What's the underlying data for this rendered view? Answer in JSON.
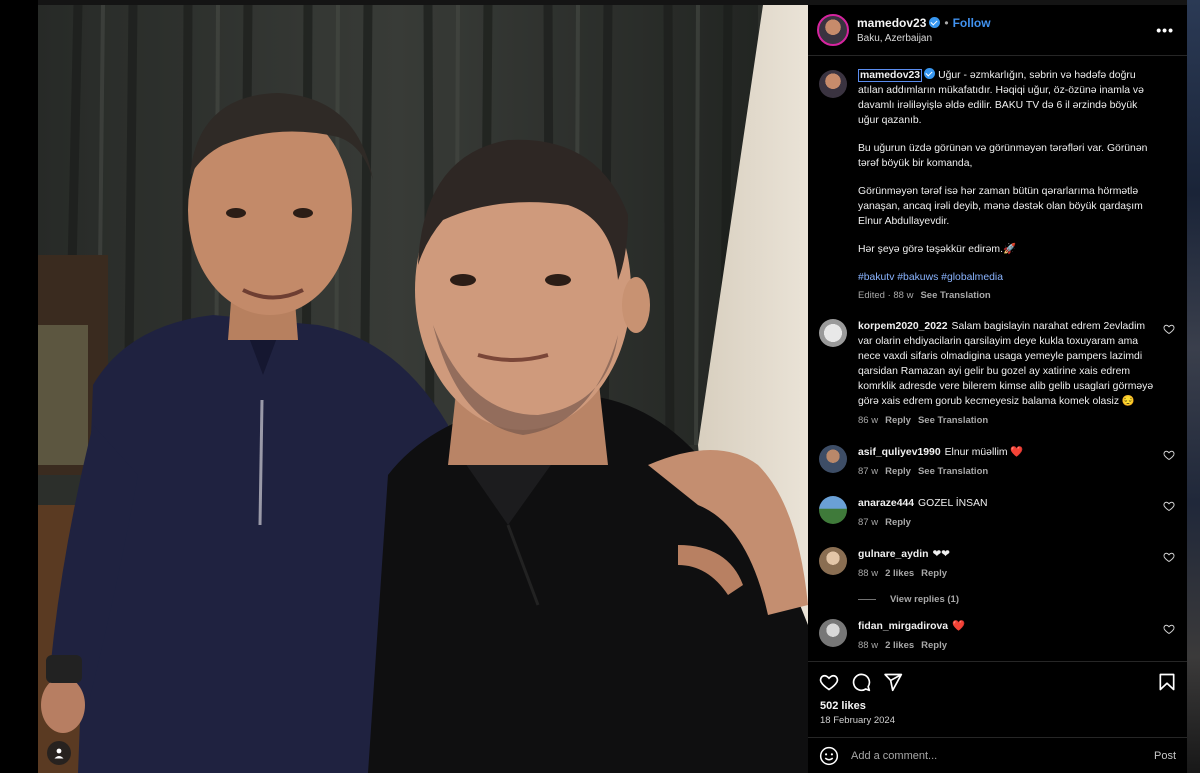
{
  "post": {
    "username": "mamedov23",
    "follow_label": "Follow",
    "dot": "•",
    "location": "Baku, Azerbaijan",
    "more_label": "•••"
  },
  "caption": {
    "username": "mamedov23",
    "p1": "Uğur - əzmkarlığın, səbrin və hədəfə doğru atılan addımların mükafatıdır. Həqiqi uğur, öz-özünə inamla və davamlı irəliləyişlə əldə edilir. BAKU TV də 6 il ərzində böyük uğur qazanıb.",
    "p2": "Bu uğurun üzdə görünən və görünməyən tərəfləri var. Görünən tərəf böyük bir komanda,",
    "p3": "Görünməyən tərəf isə hər zaman bütün qərarlarıma hörmətlə yanaşan, ancaq irəli deyib, mənə dəstək olan böyük qardaşım Elnur Abdullayevdir.",
    "p4": "Hər şeyə görə təşəkkür edirəm.🚀",
    "hashtags": "#bakutv #bakuws #globalmedia",
    "edited": "Edited · 88 w",
    "see_translation": "See Translation"
  },
  "comments": [
    {
      "user": "korpem2020_2022",
      "text": "Salam bagislayin narahat edrem 2evladim var olarin ehdiyacilarin qarsilayim deye kukla toxuyaram ama nece vaxdi sifaris olmadigina usaga yemeyle pampers lazimdi qarsidan Ramazan ayi gelir bu gozel ay xatirine xais edrem komrklik adresde vere bilerem kimse alib gelib usaglari görməyə görə xais edrem gorub kecmeyesiz balama komek olasiz 😔",
      "time": "86 w",
      "reply": "Reply",
      "translate": "See Translation",
      "likes": ""
    },
    {
      "user": "asif_quliyev1990",
      "text": "Elnur müəllim ❤️",
      "time": "87 w",
      "reply": "Reply",
      "translate": "See Translation",
      "likes": ""
    },
    {
      "user": "anaraze444",
      "text": "GOZEL İNSAN",
      "time": "87 w",
      "reply": "Reply",
      "translate": "",
      "likes": ""
    },
    {
      "user": "gulnare_aydin",
      "text": "❤❤",
      "time": "88 w",
      "reply": "Reply",
      "translate": "",
      "likes": "2 likes"
    },
    {
      "user": "fidan_mirgadirova",
      "text": "❤️",
      "time": "88 w",
      "reply": "Reply",
      "translate": "",
      "likes": "2 likes"
    }
  ],
  "view_replies": "View replies (1)",
  "likes_count": "502 likes",
  "post_date": "18 February 2024",
  "comment_box": {
    "placeholder": "Add a comment...",
    "post_label": "Post"
  },
  "colors": {
    "accent": "#4192ef",
    "heart": "#ed4956",
    "panel_bg": "#000000"
  },
  "icons": [
    "heart-icon",
    "comment-icon",
    "share-icon",
    "bookmark-icon",
    "emoji-icon",
    "more-icon",
    "user-tag-icon"
  ]
}
